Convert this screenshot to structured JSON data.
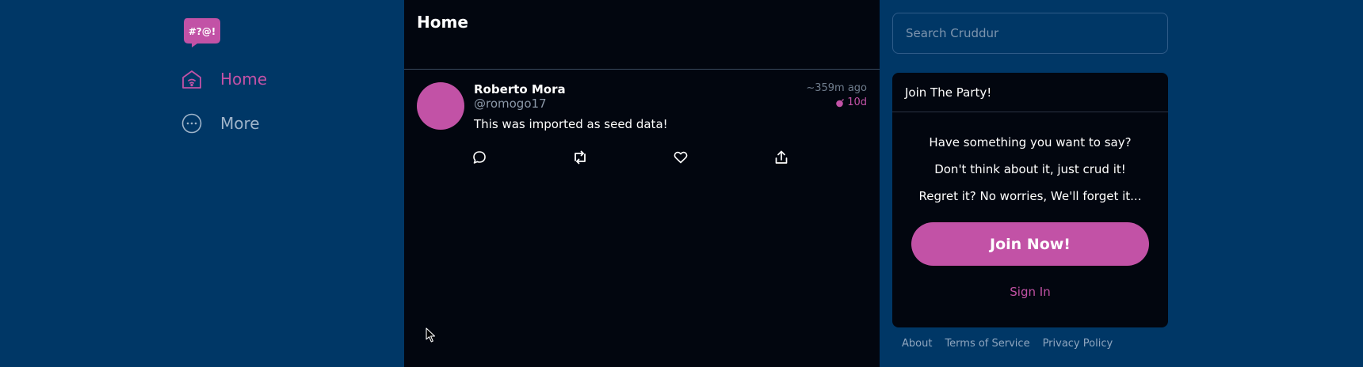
{
  "logo": {
    "text": "#?@!"
  },
  "nav": {
    "home_label": "Home",
    "more_label": "More"
  },
  "feed": {
    "title": "Home",
    "post": {
      "author": "Roberto Mora",
      "handle": "@romogo17",
      "time": "~359m ago",
      "expiry": "10d",
      "text": "This was imported as seed data!"
    }
  },
  "search": {
    "placeholder": "Search Cruddur"
  },
  "party": {
    "title": "Join The Party!",
    "line1": "Have something you want to say?",
    "line2": "Don't think about it, just crud it!",
    "line3": "Regret it? No worries, We'll forget it...",
    "join_label": "Join Now!",
    "signin_label": "Sign In"
  },
  "footer": {
    "about": "About",
    "terms": "Terms of Service",
    "privacy": "Privacy Policy"
  },
  "colors": {
    "accent": "#c252a6",
    "sidebar_bg": "#003766",
    "panel_bg": "#02060f"
  }
}
